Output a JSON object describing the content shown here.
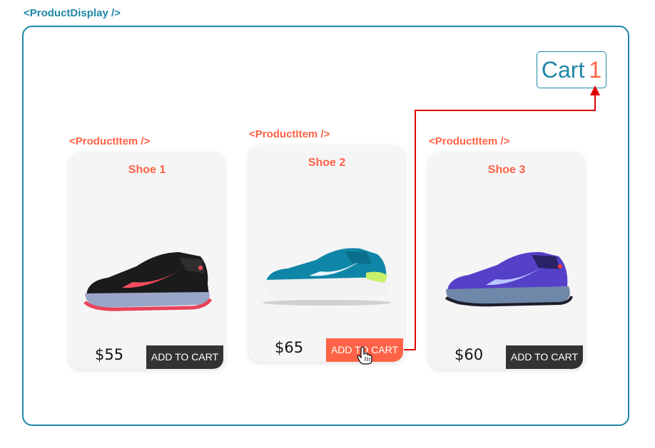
{
  "display": {
    "tag": "<ProductDisplay />"
  },
  "cart": {
    "label": "Cart",
    "count": "1"
  },
  "products": [
    {
      "tag": "<ProductItem />",
      "name": "Shoe 1",
      "price": "$55",
      "button": "ADD TO CART"
    },
    {
      "tag": "<ProductItem />",
      "name": "Shoe 2",
      "price": "$65",
      "button": "ADD TO CART"
    },
    {
      "tag": "<ProductItem />",
      "name": "Shoe 3",
      "price": "$60",
      "button": "ADD TO CART"
    }
  ],
  "colors": {
    "display_border": "#1f87a8",
    "accent": "#ff6347",
    "button_dark": "#333333",
    "arrow": "#e00000"
  },
  "icons": [
    "shoe-1-image",
    "shoe-2-image",
    "shoe-3-image",
    "hand-cursor-icon",
    "arrow-connector"
  ]
}
